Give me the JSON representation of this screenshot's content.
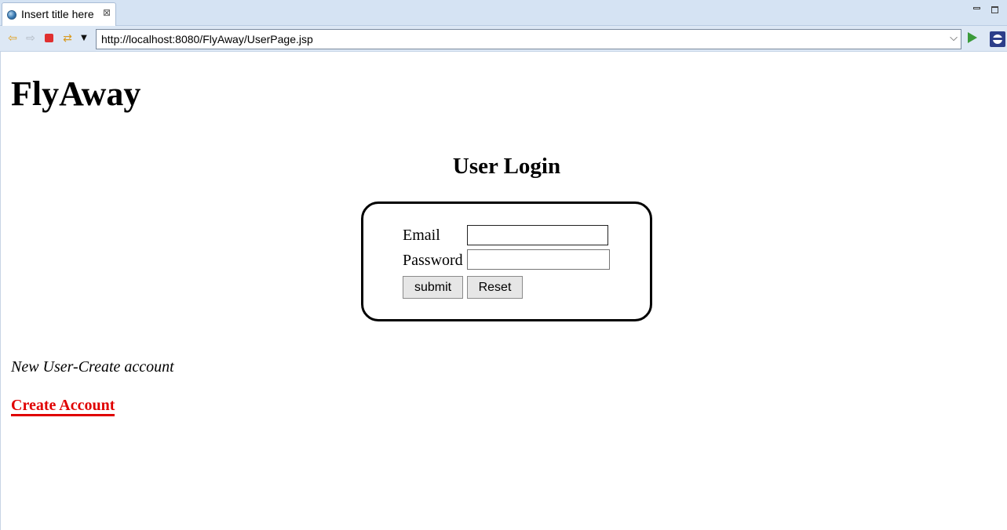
{
  "browser": {
    "tab_title": "Insert title here",
    "tab_close_glyph": "⊠",
    "url": "http://localhost:8080/FlyAway/UserPage.jsp",
    "url_dropdown_glyph": "⌵",
    "back_glyph": "⇦",
    "forward_glyph": "⇨",
    "refresh_glyph": "⇄",
    "menu_glyph": "▼",
    "icons": [
      "globe-icon",
      "close-icon",
      "minimize-icon",
      "maximize-icon",
      "back-icon",
      "forward-icon",
      "stop-icon",
      "refresh-icon",
      "dropdown-icon",
      "go-icon",
      "eclipse-icon"
    ]
  },
  "page": {
    "site_title": "FlyAway",
    "login_heading": "User Login",
    "form": {
      "email_label": "Email",
      "email_value": "",
      "password_label": "Password",
      "password_value": "",
      "submit_label": "submit",
      "reset_label": "Reset"
    },
    "new_user_text": "New User-Create account",
    "create_account_link": "Create Account"
  },
  "colors": {
    "link": "#e00000",
    "chrome_tabbar": "#d5e3f3",
    "chrome_toolbar": "#dde8f5"
  }
}
